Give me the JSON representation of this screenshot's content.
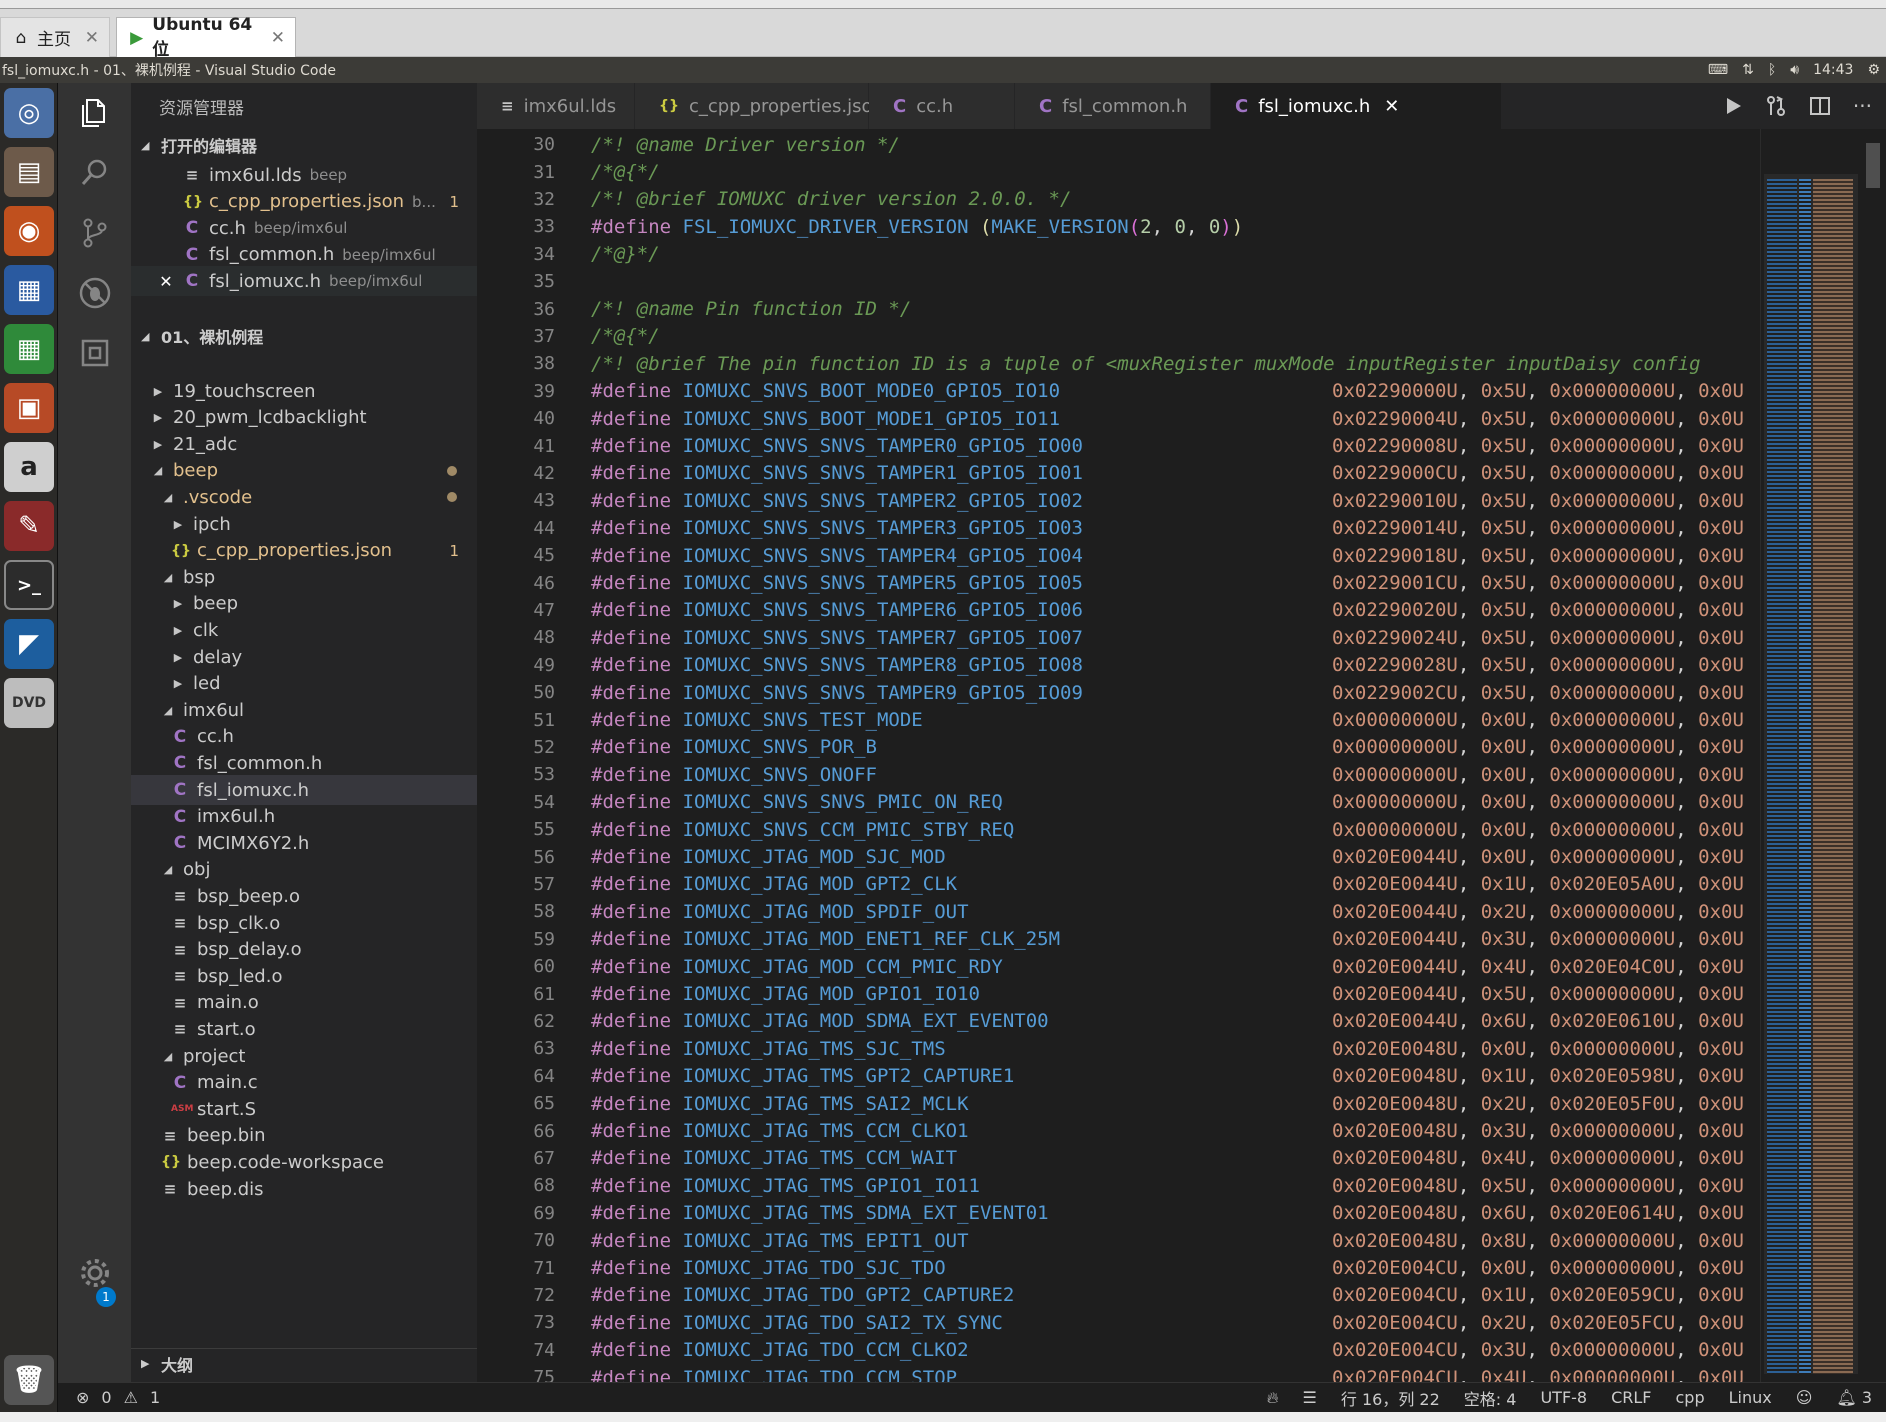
{
  "vm": {
    "home_tab": "主页",
    "vm_tab": "Ubuntu 64 位"
  },
  "panel": {
    "title": "fsl_iomuxc.h - 01、裸机例程 - Visual Studio Code",
    "time": "14:43"
  },
  "sidebar": {
    "header": "资源管理器",
    "open_editors_label": "打开的编辑器",
    "open_editors": [
      {
        "icon": "l",
        "name": "imx6ul.lds",
        "desc": "beep",
        "badge": ""
      },
      {
        "icon": "j",
        "name": "c_cpp_properties.json",
        "desc": "b...",
        "badge": "1"
      },
      {
        "icon": "c",
        "name": "cc.h",
        "desc": "beep/imx6ul",
        "badge": ""
      },
      {
        "icon": "c",
        "name": "fsl_common.h",
        "desc": "beep/imx6ul",
        "badge": ""
      },
      {
        "icon": "c",
        "name": "fsl_iomuxc.h",
        "desc": "beep/imx6ul",
        "badge": ""
      }
    ],
    "workspace_label": "01、裸机例程",
    "tree": [
      {
        "d": 1,
        "t": "c",
        "name": "19_touchscreen"
      },
      {
        "d": 1,
        "t": "c",
        "name": "20_pwm_lcdbacklight"
      },
      {
        "d": 1,
        "t": "c",
        "name": "21_adc"
      },
      {
        "d": 1,
        "t": "o",
        "name": "beep",
        "mod": true
      },
      {
        "d": 2,
        "t": "o",
        "name": ".vscode",
        "mod": true
      },
      {
        "d": 3,
        "t": "c",
        "name": "ipch"
      },
      {
        "d": 3,
        "t": "j",
        "name": "c_cpp_properties.json",
        "mod": true,
        "badge": "1"
      },
      {
        "d": 2,
        "t": "o",
        "name": "bsp"
      },
      {
        "d": 3,
        "t": "c",
        "name": "beep"
      },
      {
        "d": 3,
        "t": "c",
        "name": "clk"
      },
      {
        "d": 3,
        "t": "c",
        "name": "delay"
      },
      {
        "d": 3,
        "t": "c",
        "name": "led"
      },
      {
        "d": 2,
        "t": "o",
        "name": "imx6ul"
      },
      {
        "d": 3,
        "t": "cf",
        "name": "cc.h"
      },
      {
        "d": 3,
        "t": "cf",
        "name": "fsl_common.h"
      },
      {
        "d": 3,
        "t": "cf",
        "name": "fsl_iomuxc.h",
        "sel": true
      },
      {
        "d": 3,
        "t": "cf",
        "name": "imx6ul.h"
      },
      {
        "d": 3,
        "t": "cf",
        "name": "MCIMX6Y2.h"
      },
      {
        "d": 2,
        "t": "o",
        "name": "obj"
      },
      {
        "d": 3,
        "t": "lf",
        "name": "bsp_beep.o"
      },
      {
        "d": 3,
        "t": "lf",
        "name": "bsp_clk.o"
      },
      {
        "d": 3,
        "t": "lf",
        "name": "bsp_delay.o"
      },
      {
        "d": 3,
        "t": "lf",
        "name": "bsp_led.o"
      },
      {
        "d": 3,
        "t": "lf",
        "name": "main.o"
      },
      {
        "d": 3,
        "t": "lf",
        "name": "start.o"
      },
      {
        "d": 2,
        "t": "o",
        "name": "project"
      },
      {
        "d": 3,
        "t": "cf",
        "name": "main.c"
      },
      {
        "d": 3,
        "t": "af",
        "name": "start.S"
      },
      {
        "d": 2,
        "t": "lf",
        "name": "beep.bin"
      },
      {
        "d": 2,
        "t": "jf",
        "name": "beep.code-workspace"
      },
      {
        "d": 2,
        "t": "lf",
        "name": "beep.dis"
      }
    ],
    "outline_label": "大纲",
    "settings_badge": "1"
  },
  "tabs": [
    {
      "icon": "l",
      "name": "imx6ul.lds"
    },
    {
      "icon": "j",
      "name": "c_cpp_properties.json"
    },
    {
      "icon": "c",
      "name": "cc.h"
    },
    {
      "icon": "c",
      "name": "fsl_common.h"
    },
    {
      "icon": "c",
      "name": "fsl_iomuxc.h",
      "active": true
    }
  ],
  "editor": {
    "comment_lines": [
      {
        "ln": "30",
        "text": "/*! @name Driver version */"
      },
      {
        "ln": "31",
        "text": "/*@{*/"
      },
      {
        "ln": "32",
        "text": "/*! @brief IOMUXC driver version 2.0.0. */"
      },
      {
        "ln": "34",
        "text": "/*@}*/"
      },
      {
        "ln": "35",
        "text": ""
      },
      {
        "ln": "36",
        "text": "/*! @name Pin function ID */"
      },
      {
        "ln": "37",
        "text": "/*@{*/"
      },
      {
        "ln": "38",
        "text": "/*! @brief The pin function ID is a tuple of <muxRegister muxMode inputRegister inputDaisy config"
      }
    ],
    "version_line": {
      "ln": "33",
      "kw": "#define",
      "name": "FSL_IOMUXC_DRIVER_VERSION",
      "fn": "MAKE_VERSION",
      "args": [
        "2",
        "0",
        "0"
      ]
    },
    "defines": [
      {
        "ln": "39",
        "name": "IOMUXC_SNVS_BOOT_MODE0_GPIO5_IO10",
        "reg": "0x02290000U",
        "mode": "0x5U",
        "input": "0x00000000U"
      },
      {
        "ln": "40",
        "name": "IOMUXC_SNVS_BOOT_MODE1_GPIO5_IO11",
        "reg": "0x02290004U",
        "mode": "0x5U",
        "input": "0x00000000U"
      },
      {
        "ln": "41",
        "name": "IOMUXC_SNVS_SNVS_TAMPER0_GPIO5_IO00",
        "reg": "0x02290008U",
        "mode": "0x5U",
        "input": "0x00000000U"
      },
      {
        "ln": "42",
        "name": "IOMUXC_SNVS_SNVS_TAMPER1_GPIO5_IO01",
        "reg": "0x0229000CU",
        "mode": "0x5U",
        "input": "0x00000000U"
      },
      {
        "ln": "43",
        "name": "IOMUXC_SNVS_SNVS_TAMPER2_GPIO5_IO02",
        "reg": "0x02290010U",
        "mode": "0x5U",
        "input": "0x00000000U"
      },
      {
        "ln": "44",
        "name": "IOMUXC_SNVS_SNVS_TAMPER3_GPIO5_IO03",
        "reg": "0x02290014U",
        "mode": "0x5U",
        "input": "0x00000000U"
      },
      {
        "ln": "45",
        "name": "IOMUXC_SNVS_SNVS_TAMPER4_GPIO5_IO04",
        "reg": "0x02290018U",
        "mode": "0x5U",
        "input": "0x00000000U"
      },
      {
        "ln": "46",
        "name": "IOMUXC_SNVS_SNVS_TAMPER5_GPIO5_IO05",
        "reg": "0x0229001CU",
        "mode": "0x5U",
        "input": "0x00000000U"
      },
      {
        "ln": "47",
        "name": "IOMUXC_SNVS_SNVS_TAMPER6_GPIO5_IO06",
        "reg": "0x02290020U",
        "mode": "0x5U",
        "input": "0x00000000U"
      },
      {
        "ln": "48",
        "name": "IOMUXC_SNVS_SNVS_TAMPER7_GPIO5_IO07",
        "reg": "0x02290024U",
        "mode": "0x5U",
        "input": "0x00000000U"
      },
      {
        "ln": "49",
        "name": "IOMUXC_SNVS_SNVS_TAMPER8_GPIO5_IO08",
        "reg": "0x02290028U",
        "mode": "0x5U",
        "input": "0x00000000U"
      },
      {
        "ln": "50",
        "name": "IOMUXC_SNVS_SNVS_TAMPER9_GPIO5_IO09",
        "reg": "0x0229002CU",
        "mode": "0x5U",
        "input": "0x00000000U"
      },
      {
        "ln": "51",
        "name": "IOMUXC_SNVS_TEST_MODE",
        "reg": "0x00000000U",
        "mode": "0x0U",
        "input": "0x00000000U"
      },
      {
        "ln": "52",
        "name": "IOMUXC_SNVS_POR_B",
        "reg": "0x00000000U",
        "mode": "0x0U",
        "input": "0x00000000U"
      },
      {
        "ln": "53",
        "name": "IOMUXC_SNVS_ONOFF",
        "reg": "0x00000000U",
        "mode": "0x0U",
        "input": "0x00000000U"
      },
      {
        "ln": "54",
        "name": "IOMUXC_SNVS_SNVS_PMIC_ON_REQ",
        "reg": "0x00000000U",
        "mode": "0x0U",
        "input": "0x00000000U"
      },
      {
        "ln": "55",
        "name": "IOMUXC_SNVS_CCM_PMIC_STBY_REQ",
        "reg": "0x00000000U",
        "mode": "0x0U",
        "input": "0x00000000U"
      },
      {
        "ln": "56",
        "name": "IOMUXC_JTAG_MOD_SJC_MOD",
        "reg": "0x020E0044U",
        "mode": "0x0U",
        "input": "0x00000000U"
      },
      {
        "ln": "57",
        "name": "IOMUXC_JTAG_MOD_GPT2_CLK",
        "reg": "0x020E0044U",
        "mode": "0x1U",
        "input": "0x020E05A0U"
      },
      {
        "ln": "58",
        "name": "IOMUXC_JTAG_MOD_SPDIF_OUT",
        "reg": "0x020E0044U",
        "mode": "0x2U",
        "input": "0x00000000U"
      },
      {
        "ln": "59",
        "name": "IOMUXC_JTAG_MOD_ENET1_REF_CLK_25M",
        "reg": "0x020E0044U",
        "mode": "0x3U",
        "input": "0x00000000U"
      },
      {
        "ln": "60",
        "name": "IOMUXC_JTAG_MOD_CCM_PMIC_RDY",
        "reg": "0x020E0044U",
        "mode": "0x4U",
        "input": "0x020E04C0U"
      },
      {
        "ln": "61",
        "name": "IOMUXC_JTAG_MOD_GPIO1_IO10",
        "reg": "0x020E0044U",
        "mode": "0x5U",
        "input": "0x00000000U"
      },
      {
        "ln": "62",
        "name": "IOMUXC_JTAG_MOD_SDMA_EXT_EVENT00",
        "reg": "0x020E0044U",
        "mode": "0x6U",
        "input": "0x020E0610U"
      },
      {
        "ln": "63",
        "name": "IOMUXC_JTAG_TMS_SJC_TMS",
        "reg": "0x020E0048U",
        "mode": "0x0U",
        "input": "0x00000000U"
      },
      {
        "ln": "64",
        "name": "IOMUXC_JTAG_TMS_GPT2_CAPTURE1",
        "reg": "0x020E0048U",
        "mode": "0x1U",
        "input": "0x020E0598U"
      },
      {
        "ln": "65",
        "name": "IOMUXC_JTAG_TMS_SAI2_MCLK",
        "reg": "0x020E0048U",
        "mode": "0x2U",
        "input": "0x020E05F0U"
      },
      {
        "ln": "66",
        "name": "IOMUXC_JTAG_TMS_CCM_CLKO1",
        "reg": "0x020E0048U",
        "mode": "0x3U",
        "input": "0x00000000U"
      },
      {
        "ln": "67",
        "name": "IOMUXC_JTAG_TMS_CCM_WAIT",
        "reg": "0x020E0048U",
        "mode": "0x4U",
        "input": "0x00000000U"
      },
      {
        "ln": "68",
        "name": "IOMUXC_JTAG_TMS_GPIO1_IO11",
        "reg": "0x020E0048U",
        "mode": "0x5U",
        "input": "0x00000000U"
      },
      {
        "ln": "69",
        "name": "IOMUXC_JTAG_TMS_SDMA_EXT_EVENT01",
        "reg": "0x020E0048U",
        "mode": "0x6U",
        "input": "0x020E0614U"
      },
      {
        "ln": "70",
        "name": "IOMUXC_JTAG_TMS_EPIT1_OUT",
        "reg": "0x020E0048U",
        "mode": "0x8U",
        "input": "0x00000000U"
      },
      {
        "ln": "71",
        "name": "IOMUXC_JTAG_TDO_SJC_TDO",
        "reg": "0x020E004CU",
        "mode": "0x0U",
        "input": "0x00000000U"
      },
      {
        "ln": "72",
        "name": "IOMUXC_JTAG_TDO_GPT2_CAPTURE2",
        "reg": "0x020E004CU",
        "mode": "0x1U",
        "input": "0x020E059CU"
      },
      {
        "ln": "73",
        "name": "IOMUXC_JTAG_TDO_SAI2_TX_SYNC",
        "reg": "0x020E004CU",
        "mode": "0x2U",
        "input": "0x020E05FCU"
      },
      {
        "ln": "74",
        "name": "IOMUXC_JTAG_TDO_CCM_CLKO2",
        "reg": "0x020E004CU",
        "mode": "0x3U",
        "input": "0x00000000U"
      },
      {
        "ln": "75",
        "name": "IOMUXC_JTAG_TDO_CCM_STOP",
        "reg": "0x020E004CU",
        "mode": "0x4U",
        "input": "0x00000000U"
      }
    ],
    "trail": "0x0U",
    "define_kw": "#define"
  },
  "status": {
    "errors": "0",
    "warnings": "1",
    "position": "行 16，列 22",
    "spaces": "空格: 4",
    "encoding": "UTF-8",
    "eol": "CRLF",
    "language": "cpp",
    "os": "Linux",
    "notifications": "3"
  },
  "colors": {
    "keyword": "#c586c0",
    "macro": "#569cd6",
    "hex": "#ce9178",
    "comment": "#6a9955"
  }
}
